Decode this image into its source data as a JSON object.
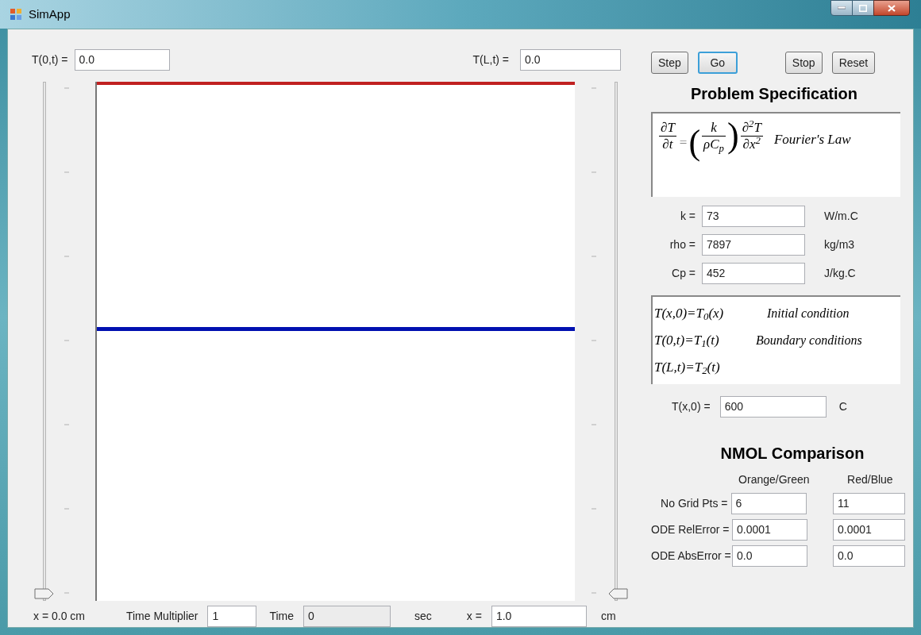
{
  "window": {
    "title": "SimApp"
  },
  "boundary_left": {
    "label": "T(0,t) =",
    "value": "0.0"
  },
  "boundary_right": {
    "label": "T(L,t) =",
    "value": "0.0"
  },
  "sliders": [
    {
      "level": 0
    },
    {
      "level": 0
    }
  ],
  "position_label": "x = 0.0 cm",
  "time_multiplier": {
    "label": "Time Multiplier",
    "value": "1"
  },
  "time": {
    "label": "Time",
    "value": "0",
    "unit": "sec",
    "disabled": true
  },
  "x_field": {
    "label": "x =",
    "value": "1.0",
    "unit": "cm"
  },
  "buttons": [
    {
      "label": "Step",
      "focused": false
    },
    {
      "label": "Go",
      "focused": true
    },
    {
      "label": "Stop",
      "focused": false
    },
    {
      "label": "Reset",
      "focused": false
    }
  ],
  "problem": {
    "heading": "Problem Specification",
    "equation": {
      "lhs_num": "∂T",
      "lhs_den": "∂t",
      "equals": "=",
      "open": "(",
      "coef_num": "k",
      "coef_den": "ρC$_{p}$",
      "close": ")",
      "rhs_num": "∂$^{2}$T",
      "rhs_den": "∂x$^{2}$",
      "name": "Fourier's Law"
    },
    "parameters": [
      {
        "label": "k =",
        "value": "73",
        "unit": "W/m.C"
      },
      {
        "label": "rho =",
        "value": "7897",
        "unit": "kg/m3"
      },
      {
        "label": "Cp =",
        "value": "452",
        "unit": "J/kg.C"
      }
    ],
    "conditions": [
      {
        "equation": "T(x,0)=T$_{0}$(x)",
        "note": "Initial condition"
      },
      {
        "equation": "T(0,t)=T$_{1}$(t)",
        "note": "Boundary conditions"
      },
      {
        "equation": "T(L,t)=T$_{2}$(t)"
      }
    ],
    "initial": {
      "label": "T(x,0) =",
      "value": "600",
      "unit": "C"
    }
  },
  "comparison": {
    "heading": "NMOL Comparison",
    "columns": [
      "Orange/Green",
      "Red/Blue"
    ],
    "rows": [
      {
        "label": "No Grid Pts =",
        "values": [
          "6",
          "11"
        ]
      },
      {
        "label": "ODE RelError =",
        "values": [
          "0.0001",
          "0.0001"
        ]
      },
      {
        "label": "ODE AbsError =",
        "values": [
          "0.0",
          "0.0"
        ]
      }
    ]
  }
}
